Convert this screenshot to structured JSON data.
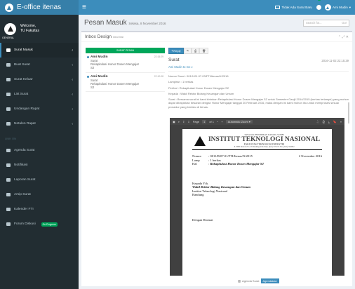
{
  "app": {
    "title": "E-office itenas"
  },
  "topbar": {
    "message_text": "Tidak Ada Surat Baru",
    "user_name": "Ami Mudin"
  },
  "user_panel": {
    "welcome": "Welcome,",
    "unit": "TU Fakultas",
    "role": "GENERAL"
  },
  "sidebar": {
    "items": [
      {
        "label": "Surat Masuk",
        "icon": "inbox-icon",
        "active": true
      },
      {
        "label": "Buat Surat",
        "icon": "edit-icon"
      },
      {
        "label": "Surat Keluar",
        "icon": "send-icon"
      },
      {
        "label": "List Surat",
        "icon": "list-icon"
      },
      {
        "label": "Undangan Rapat",
        "icon": "mail-open-icon"
      },
      {
        "label": "Notulen Rapat",
        "icon": "notes-icon"
      }
    ],
    "section_header": "LINK ON",
    "links": [
      {
        "label": "Agenda Surat",
        "icon": "book-icon"
      },
      {
        "label": "Notifikasi",
        "icon": "bell-icon"
      },
      {
        "label": "Laporan Surat",
        "icon": "report-icon"
      },
      {
        "label": "Arsip Surat",
        "icon": "archive-icon"
      },
      {
        "label": "Kalender FTI",
        "icon": "calendar-icon"
      },
      {
        "label": "Forum Diskusi",
        "icon": "chat-icon",
        "pill": "On Progress"
      }
    ]
  },
  "content": {
    "title": "Pesan Masuk",
    "subtitle": "Selasa, 8 November 2016",
    "search_placeholder": "Search for...",
    "search_button": "Go!"
  },
  "inbox": {
    "title": "Inbox Design",
    "subtitle": "Ideal Mail",
    "surat_button": "SURAT PESAN",
    "mails": [
      {
        "from": "Ami Mudin",
        "time": "22:15:29",
        "lines": [
          "Surat",
          "Rekapitulasi Honor Dosen Mengajar",
          "S2"
        ]
      },
      {
        "from": "Ami Mudin",
        "time": "22:10:08",
        "lines": [
          "Surat",
          "Rekapitulasi Honor Dosen Mengajar",
          "S2"
        ]
      }
    ]
  },
  "reader": {
    "reply_label": "Reply",
    "subject": "Surat",
    "datetime": "2016-11-02 22:15:29",
    "to": "Ami Mudin to me",
    "nomor": "Nomor Surat : 001/1/01.07.03/FTI/Itenas/X/2016",
    "lampiran": "Lampiran : 1 berkas",
    "perihal": "Perihal : Rekapitulasi Honor Dosen Mengajar S2",
    "kepada": "Kepada : Wakil Rektor Bidang Keuangan dan Umum",
    "isi": "Surat : Bersama surat ini kami kirimkan Rekapitulasi Honor Dosen Mengajar S2 untuk Semester Ganjil 2014/2015 (berkas terlampir) yang mohon dapat dibayarkan besaran dengan Honor Mengajar tanggal 20 Februari 2016, maka dengan ini kami mohon ibu untuk memproses sesuai prosedur yang berlaku di itenas.",
    "pdf": {
      "page_label": "Page",
      "page_num": "1",
      "page_of": "of 1",
      "zoom": "Automatic Zoom",
      "letterhead_top": "YAYASAN PENDIDIKAN DAYANG SUMBI",
      "letterhead_main": "INSTITUT TEKNOLOGI NASIONAL",
      "letterhead_sub": "FAKULTAS TEKNOLOGI INDUSTRI",
      "letterhead_addr": "Jl. PHH. Mustofa No. 23 Bandung 40124 Telp. (022) 7272215 Fax. (022) 7202892",
      "nomor_k": "Nomor",
      "nomor_v": ": 0011/B/07.01/FTI/Itenas/X/2015",
      "lamp_k": "Lamp",
      "lamp_v": ": 1 berkas",
      "hal_k": "Hal",
      "hal_v": "Rekapitulasi Honor Dosen Mengajar S2",
      "date": "2 November 2016",
      "kepada": "Kepada Yth.",
      "recipient": "Wakil Rektor Bidang Keuangan dan Umum",
      "inst": "Institut Teknologi Nasional",
      "city": "Bandung",
      "closing": "Dengan Hormat"
    },
    "agenda_label": "Agenda Surat",
    "agendakan_button": "Agendakan"
  }
}
